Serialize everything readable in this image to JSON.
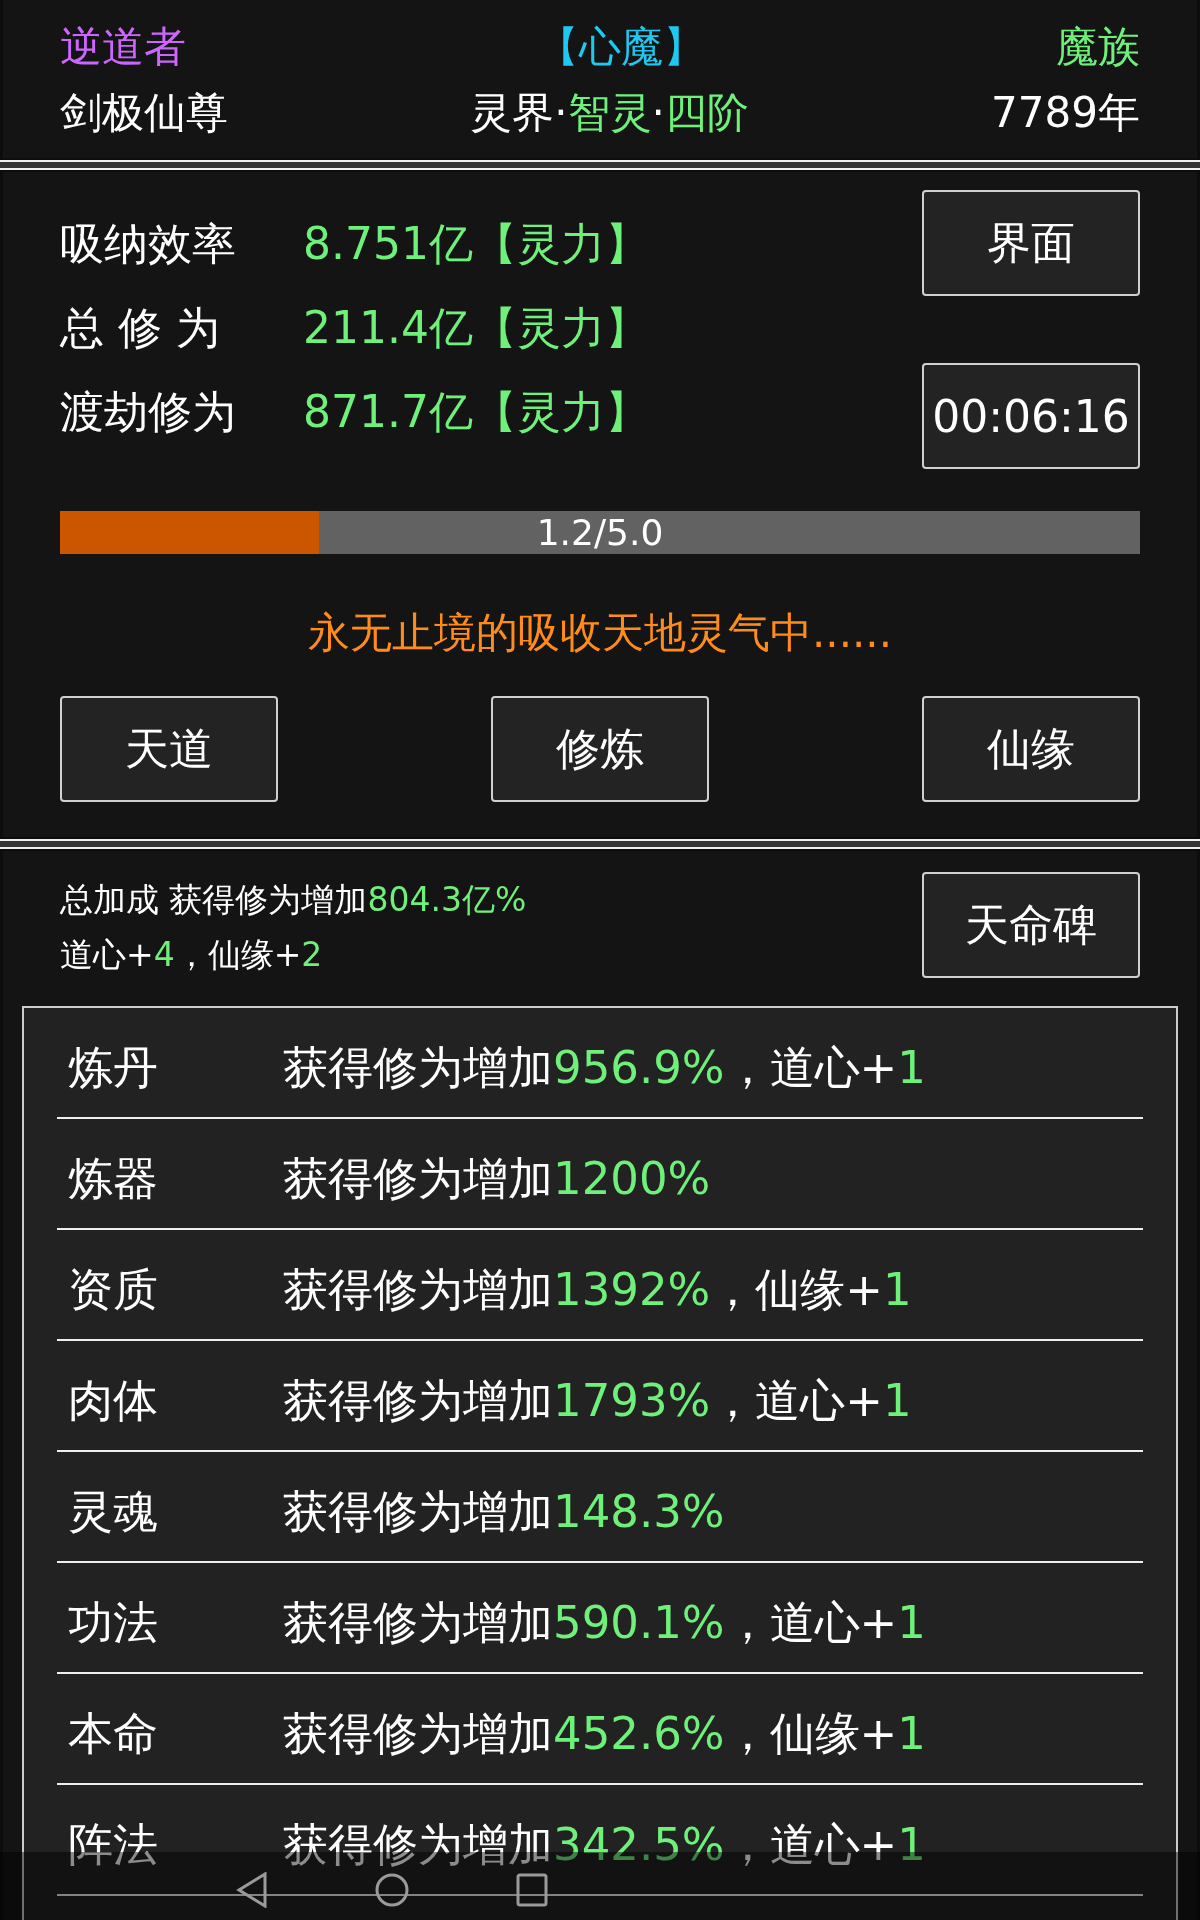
{
  "header": {
    "title": "逆道者",
    "status": "【心魔】",
    "race": "魔族",
    "rank": "剑极仙尊",
    "realm": [
      {
        "text": "灵界·",
        "highlight": false
      },
      {
        "text": "智灵",
        "highlight": true
      },
      {
        "text": "·",
        "highlight": false
      },
      {
        "text": "四阶",
        "highlight": true
      }
    ],
    "age": "7789年"
  },
  "stats": [
    {
      "label": "吸纳效率",
      "value": "8.751亿【灵力】"
    },
    {
      "label": "总 修 为",
      "value": "211.4亿【灵力】"
    },
    {
      "label": "渡劫修为",
      "value": "871.7亿【灵力】"
    }
  ],
  "side_buttons": [
    "界面",
    "00:06:16"
  ],
  "progress": {
    "level": 0.24,
    "reading": "1.2/5.0"
  },
  "message": "永无止境的吸收天地灵气中......",
  "actions": [
    "天道",
    "修炼",
    "仙缘"
  ],
  "summary": [
    [
      {
        "text": "总加成 获得修为增加",
        "highlight": false
      },
      {
        "text": "804.3亿%",
        "highlight": true
      }
    ],
    [
      {
        "text": "道心+",
        "highlight": false
      },
      {
        "text": "4",
        "highlight": true
      },
      {
        "text": "，仙缘+",
        "highlight": false
      },
      {
        "text": "2",
        "highlight": true
      }
    ]
  ],
  "summary_button": "天命碑",
  "bonuses": [
    {
      "name": "炼丹",
      "effect": [
        {
          "text": "获得修为增加",
          "highlight": false
        },
        {
          "text": "956.9%",
          "highlight": true
        },
        {
          "text": "，道心+",
          "highlight": false
        },
        {
          "text": "1",
          "highlight": true
        }
      ]
    },
    {
      "name": "炼器",
      "effect": [
        {
          "text": "获得修为增加",
          "highlight": false
        },
        {
          "text": "1200%",
          "highlight": true
        }
      ]
    },
    {
      "name": "资质",
      "effect": [
        {
          "text": "获得修为增加",
          "highlight": false
        },
        {
          "text": "1392%",
          "highlight": true
        },
        {
          "text": "，仙缘+",
          "highlight": false
        },
        {
          "text": "1",
          "highlight": true
        }
      ]
    },
    {
      "name": "肉体",
      "effect": [
        {
          "text": "获得修为增加",
          "highlight": false
        },
        {
          "text": "1793%",
          "highlight": true
        },
        {
          "text": "，道心+",
          "highlight": false
        },
        {
          "text": "1",
          "highlight": true
        }
      ]
    },
    {
      "name": "灵魂",
      "effect": [
        {
          "text": "获得修为增加",
          "highlight": false
        },
        {
          "text": "148.3%",
          "highlight": true
        }
      ]
    },
    {
      "name": "功法",
      "effect": [
        {
          "text": "获得修为增加",
          "highlight": false
        },
        {
          "text": "590.1%",
          "highlight": true
        },
        {
          "text": "，道心+",
          "highlight": false
        },
        {
          "text": "1",
          "highlight": true
        }
      ]
    },
    {
      "name": "本命",
      "effect": [
        {
          "text": "获得修为增加",
          "highlight": false
        },
        {
          "text": "452.6%",
          "highlight": true
        },
        {
          "text": "，仙缘+",
          "highlight": false
        },
        {
          "text": "1",
          "highlight": true
        }
      ]
    },
    {
      "name": "阵法",
      "effect": [
        {
          "text": "获得修为增加",
          "highlight": false
        },
        {
          "text": "342.5%",
          "highlight": true
        },
        {
          "text": "，道心+",
          "highlight": false
        },
        {
          "text": "1",
          "highlight": true
        }
      ]
    }
  ]
}
